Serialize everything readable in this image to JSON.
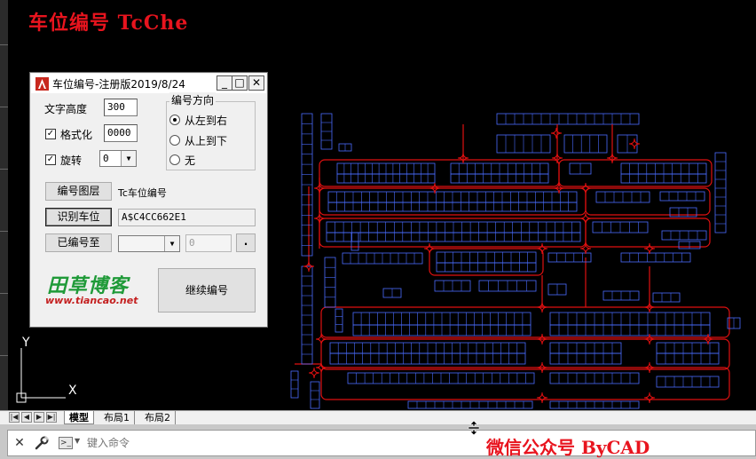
{
  "overlay": {
    "title_top": "车位编号 TcChe",
    "title_bottom": "微信公众号 ByCAD"
  },
  "dialog": {
    "title": "车位编号-注册版2019/8/24",
    "window_buttons": {
      "minimize": "_",
      "maximize": "□",
      "close": "✕"
    },
    "text_height_label": "文字高度",
    "text_height_value": "300",
    "format_label": "格式化",
    "format_checked": true,
    "format_value": "0000",
    "rotate_label": "旋转",
    "rotate_checked": true,
    "rotate_value": "0",
    "direction_group_title": "编号方向",
    "direction_options": [
      {
        "label": "从左到右",
        "selected": true
      },
      {
        "label": "从上到下",
        "selected": false
      },
      {
        "label": "无",
        "selected": false
      }
    ],
    "layer_button": "编号图层",
    "layer_value": "Tc车位编号",
    "identify_button": "识别车位",
    "identify_value": "A$C4CC662E1",
    "numbered_to_button": "已编号至",
    "numbered_to_select": "",
    "numbered_to_value": "0",
    "dot_button": ".",
    "continue_button": "继续编号",
    "logo_text": "田草博客",
    "logo_url": "www.tiancao.net"
  },
  "tabs": {
    "nav": [
      "|◀",
      "◀",
      "▶",
      "▶|"
    ],
    "items": [
      "模型",
      "布局1",
      "布局2"
    ],
    "active": "模型"
  },
  "command": {
    "placeholder": "键入命令"
  },
  "ucs": {
    "x_label": "X",
    "y_label": "Y"
  },
  "colors": {
    "canvas": "#000000",
    "road_lines": "#e01010",
    "parking_lines": "#4a6cff",
    "title_red": "#e8141e",
    "logo_green": "#1f9a38",
    "logo_red": "#c42020"
  },
  "icons": {
    "app": "autocad-a-icon",
    "command_close": "close-icon",
    "command_customize": "wrench-icon",
    "command_prompt": "command-prompt-icon",
    "splitter": "resize-vertical-cursor-icon"
  }
}
